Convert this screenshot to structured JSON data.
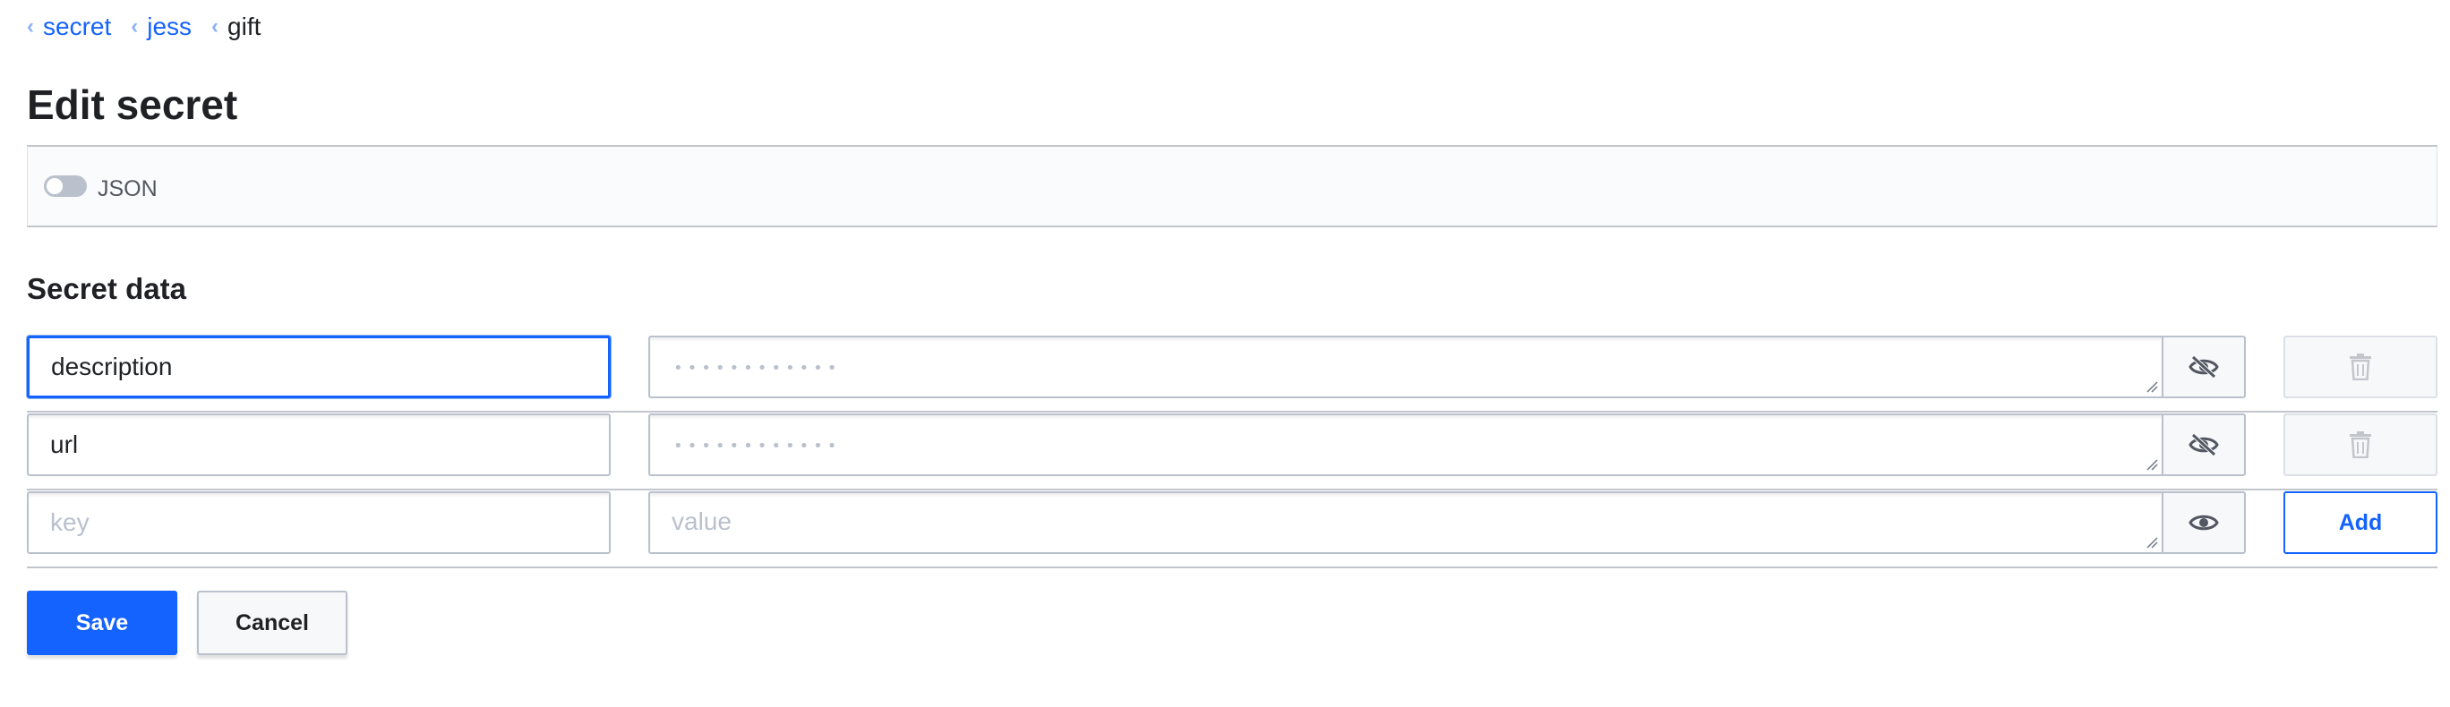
{
  "breadcrumb": {
    "items": [
      {
        "label": "secret",
        "link": true
      },
      {
        "label": "jess",
        "link": true
      },
      {
        "label": "gift",
        "link": false
      }
    ]
  },
  "page": {
    "title": "Edit secret"
  },
  "toolbar": {
    "json_toggle_label": "JSON",
    "json_toggle_on": false
  },
  "secret_data": {
    "title": "Secret data",
    "rows": [
      {
        "key": "description",
        "value_masked": "••••••••••••",
        "reveal_icon": "eye-slash-icon",
        "action_icon": "trash-icon"
      },
      {
        "key": "url",
        "value_masked": "••••••••••••",
        "reveal_icon": "eye-slash-icon",
        "action_icon": "trash-icon"
      }
    ],
    "new_row": {
      "key_placeholder": "key",
      "value_placeholder": "value",
      "reveal_icon": "eye-icon",
      "add_label": "Add"
    }
  },
  "actions": {
    "save_label": "Save",
    "cancel_label": "Cancel"
  },
  "colors": {
    "accent": "#1563ff",
    "border": "#bac1cc",
    "text": "#1f2124"
  }
}
